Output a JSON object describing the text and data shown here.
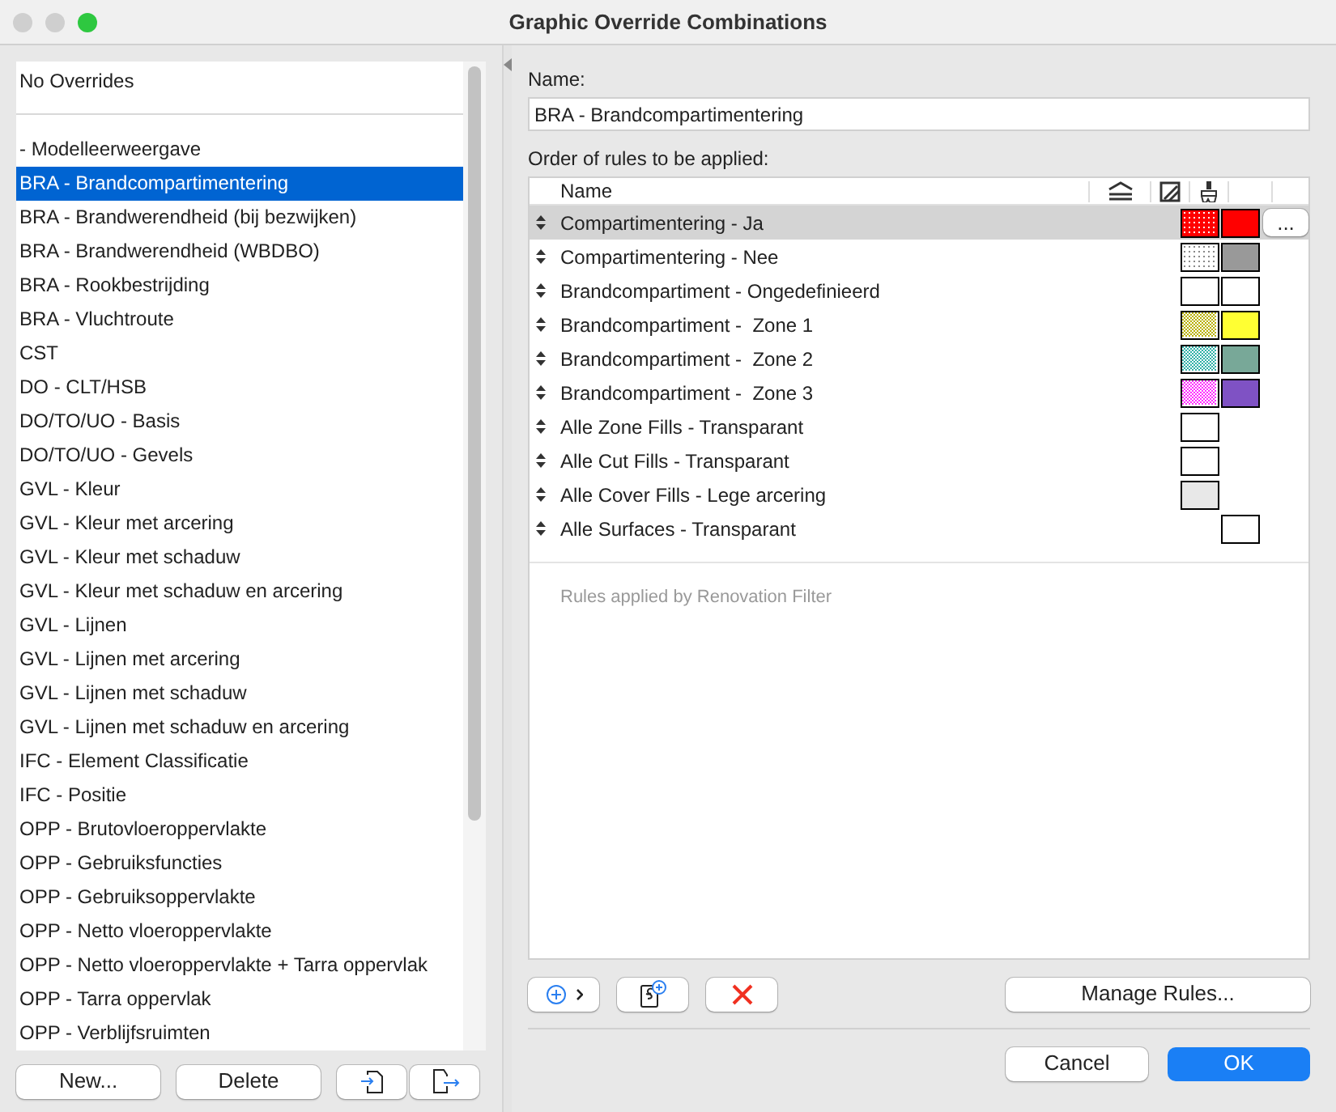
{
  "window": {
    "title": "Graphic Override Combinations"
  },
  "no_overrides": {
    "label": "No Overrides",
    "selected": false
  },
  "combinations": [
    {
      "label": "- Modelleerweergave",
      "selected": false
    },
    {
      "label": "BRA - Brandcompartimentering",
      "selected": true
    },
    {
      "label": "BRA - Brandwerendheid (bij bezwijken)",
      "selected": false
    },
    {
      "label": "BRA - Brandwerendheid (WBDBO)",
      "selected": false
    },
    {
      "label": "BRA - Rookbestrijding",
      "selected": false
    },
    {
      "label": "BRA - Vluchtroute",
      "selected": false
    },
    {
      "label": "CST",
      "selected": false
    },
    {
      "label": "DO - CLT/HSB",
      "selected": false
    },
    {
      "label": "DO/TO/UO - Basis",
      "selected": false
    },
    {
      "label": "DO/TO/UO - Gevels",
      "selected": false
    },
    {
      "label": "GVL - Kleur",
      "selected": false
    },
    {
      "label": "GVL - Kleur met arcering",
      "selected": false
    },
    {
      "label": "GVL - Kleur met schaduw",
      "selected": false
    },
    {
      "label": "GVL - Kleur met schaduw en arcering",
      "selected": false
    },
    {
      "label": "GVL - Lijnen",
      "selected": false
    },
    {
      "label": "GVL - Lijnen met arcering",
      "selected": false
    },
    {
      "label": "GVL - Lijnen met schaduw",
      "selected": false
    },
    {
      "label": "GVL - Lijnen met schaduw en arcering",
      "selected": false
    },
    {
      "label": "IFC - Element Classificatie",
      "selected": false
    },
    {
      "label": "IFC - Positie",
      "selected": false
    },
    {
      "label": "OPP - Brutovloeroppervlakte",
      "selected": false
    },
    {
      "label": "OPP - Gebruiksfuncties",
      "selected": false
    },
    {
      "label": "OPP - Gebruiksoppervlakte",
      "selected": false
    },
    {
      "label": "OPP - Netto vloeroppervlakte",
      "selected": false
    },
    {
      "label": "OPP - Netto vloeroppervlakte + Tarra oppervlak",
      "selected": false
    },
    {
      "label": "OPP - Tarra oppervlak",
      "selected": false
    },
    {
      "label": "OPP - Verblijfsruimten",
      "selected": false
    }
  ],
  "left_buttons": {
    "new": "New...",
    "delete": "Delete"
  },
  "name_field": {
    "label": "Name:",
    "value": "BRA - Brandcompartimentering"
  },
  "rules": {
    "label": "Order of rules to be applied:",
    "column_name": "Name",
    "footer": "Rules applied by Renovation Filter",
    "more_button": "...",
    "rows": [
      {
        "name": "Compartimentering - Ja",
        "selected": true,
        "fill": {
          "kind": "reverse-dots",
          "color": "#ff0000"
        },
        "surface": {
          "color": "#ff0000"
        }
      },
      {
        "name": "Compartimentering - Nee",
        "selected": false,
        "fill": {
          "kind": "dots",
          "color": "#888888"
        },
        "surface": {
          "color": "#999999"
        }
      },
      {
        "name": "Brandcompartiment - Ongedefinieerd",
        "selected": false,
        "fill": {
          "kind": "solid",
          "color": "#ffffff"
        },
        "surface": {
          "color": "#ffffff"
        }
      },
      {
        "name": "Brandcompartiment -  Zone 1",
        "selected": false,
        "fill": {
          "kind": "check",
          "color": "#b8b000"
        },
        "surface": {
          "color": "#ffff33"
        }
      },
      {
        "name": "Brandcompartiment -  Zone 2",
        "selected": false,
        "fill": {
          "kind": "check",
          "color": "#30b0a8"
        },
        "surface": {
          "color": "#78a898"
        }
      },
      {
        "name": "Brandcompartiment -  Zone 3",
        "selected": false,
        "fill": {
          "kind": "check",
          "color": "#ff30ff"
        },
        "surface": {
          "color": "#7f52c4"
        }
      },
      {
        "name": "Alle Zone Fills - Transparant",
        "selected": false,
        "fill": {
          "kind": "solid",
          "color": "#ffffff"
        }
      },
      {
        "name": "Alle Cut Fills - Transparant",
        "selected": false,
        "fill": {
          "kind": "solid",
          "color": "#ffffff"
        }
      },
      {
        "name": "Alle Cover Fills - Lege arcering",
        "selected": false,
        "fill": {
          "kind": "solid",
          "color": "#e8e8e8"
        }
      },
      {
        "name": "Alle Surfaces - Transparant",
        "selected": false,
        "surface": {
          "color": "#ffffff"
        }
      }
    ]
  },
  "manage_button": "Manage Rules...",
  "dialog_buttons": {
    "cancel": "Cancel",
    "ok": "OK"
  }
}
